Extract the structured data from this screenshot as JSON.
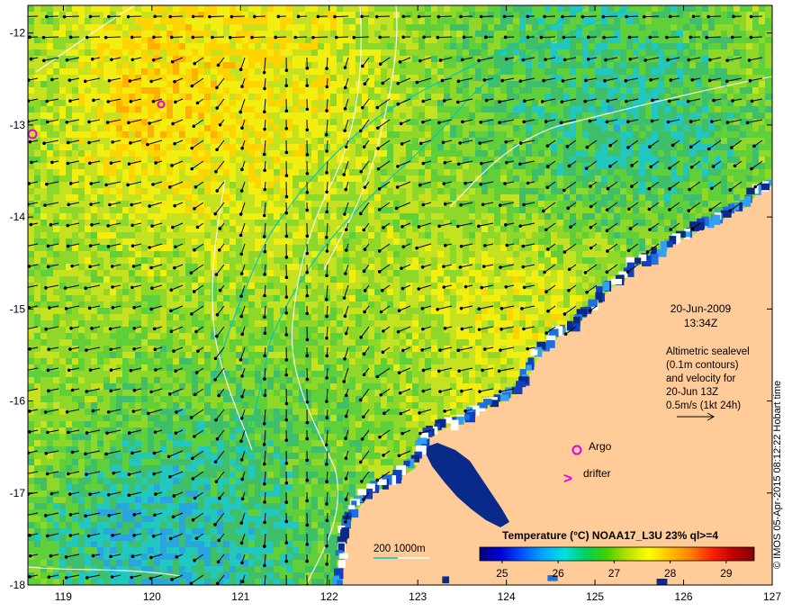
{
  "map": {
    "date": "20-Jun-2009",
    "time": "13:34Z",
    "info_lines": [
      "Altimetric sealevel",
      "(0.1m contours)",
      "and velocity for",
      "20-Jun 13Z",
      "0.5m/s (1kt 24h)"
    ],
    "credit": "© IMOS 05-Apr-2015 08:12:22 Hobart time",
    "legend": {
      "argo_label": "Argo",
      "drifter_label": "drifter",
      "drifter_symbol": ">"
    },
    "depth_label": "200  1000m",
    "x_axis": {
      "ticks": [
        "119",
        "120",
        "121",
        "122",
        "123",
        "124",
        "125",
        "126",
        "127"
      ]
    },
    "y_axis": {
      "ticks": [
        "-12",
        "-13",
        "-14",
        "-15",
        "-16",
        "-17",
        "-18"
      ]
    },
    "colorbar": {
      "title": "Temperature (°C) NOAA17_L3U 23% ql>=4",
      "ticks": [
        "25",
        "26",
        "27",
        "28",
        "29"
      ],
      "range": [
        24.6,
        29.5
      ],
      "colors": [
        "#000080",
        "#0000d8",
        "#0050ff",
        "#00a8ff",
        "#00e0e0",
        "#00d060",
        "#40d000",
        "#b8e000",
        "#ffff00",
        "#ffc000",
        "#ff8000",
        "#ff2000",
        "#c00000",
        "#800000"
      ]
    },
    "colors": {
      "land": "#ffcc99",
      "ocean_base": "#7fd42b",
      "contour": "#ffffff",
      "isobath": "#00c8c8",
      "argo": "#e000e0",
      "arrow": "#000000"
    }
  }
}
